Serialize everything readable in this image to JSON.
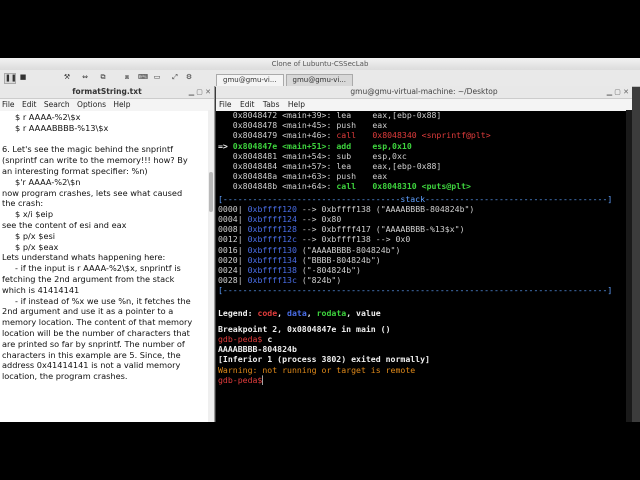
{
  "vm": {
    "title": "Clone of Lubuntu-CSSecLab",
    "pause_icon": "pause-icon",
    "tabs": [
      "gmu@gmu-vi...",
      "gmu@gmu-vi..."
    ]
  },
  "editor": {
    "title": "formatString.txt",
    "menu": [
      "File",
      "Edit",
      "Search",
      "Options",
      "Help"
    ],
    "lines": [
      "     $ r AAAA-%2\\$x",
      "     $ r AAAABBBB-%13\\$x",
      "",
      "6. Let's see the magic behind the snprintf",
      "(snprintf can write to the memory!!! how? By",
      "an interesting format specifier: %n)",
      "     $'r AAAA-%2\\$n",
      "now program crashes, lets see what caused",
      "the crash:",
      "     $ x/i $eip",
      "see the content of esi and eax",
      "     $ p/x $esi",
      "     $ p/x $eax",
      "Lets understand whats happening here:",
      "     - if the input is r AAAA-%2\\$x, snprintf is",
      "fetching the 2nd argument from the stack",
      "which is 41414141",
      "     - if instead of %x we use %n, it fetches the",
      "2nd argument and use it as a pointer to a",
      "memory location. The content of that memory",
      "location will be the number of characters that",
      "are printed so far by snprintf. The number of",
      "characters in this example are 5. Since, the",
      "address 0x41414141 is not a valid memory",
      "location, the program crashes."
    ]
  },
  "terminal": {
    "title": "gmu@gmu-virtual-machine: ~/Desktop",
    "menu": [
      "File",
      "Edit",
      "Tabs",
      "Help"
    ],
    "code": [
      {
        "arrow": "",
        "addr": "0x8048472",
        "sym": "<main+39>:",
        "op": "lea",
        "args": "eax,[ebp-0x88]",
        "hl": false
      },
      {
        "arrow": "",
        "addr": "0x8048478",
        "sym": "<main+45>:",
        "op": "push",
        "args": "eax",
        "hl": false
      },
      {
        "arrow": "",
        "addr": "0x8048479",
        "sym": "<main+46>:",
        "op": "call",
        "args": "0x8048340 <snprintf@plt>",
        "hl": false,
        "call": true
      },
      {
        "arrow": "=> ",
        "addr": "0x804847e",
        "sym": "<main+51>:",
        "op": "add",
        "args": "esp,0x10",
        "hl": true
      },
      {
        "arrow": "",
        "addr": "0x8048481",
        "sym": "<main+54>:",
        "op": "sub",
        "args": "esp,0xc",
        "hl": false
      },
      {
        "arrow": "",
        "addr": "0x8048484",
        "sym": "<main+57>:",
        "op": "lea",
        "args": "eax,[ebp-0x88]",
        "hl": false
      },
      {
        "arrow": "",
        "addr": "0x804848a",
        "sym": "<main+63>:",
        "op": "push",
        "args": "eax",
        "hl": false
      },
      {
        "arrow": "",
        "addr": "0x804848b",
        "sym": "<main+64>:",
        "op": "call",
        "args": "0x8048310 <puts@plt>",
        "hl": false,
        "call2": true
      }
    ],
    "stack_sep": "[------------------------------------stack-------------------------------------]",
    "stack": [
      {
        "off": "0000|",
        "addr": "0xbffff120",
        "rest": "--> 0xbffff138 (\"AAAABBBB-804824b\")"
      },
      {
        "off": "0004|",
        "addr": "0xbffff124",
        "rest": "--> 0x80"
      },
      {
        "off": "0008|",
        "addr": "0xbffff128",
        "rest": "--> 0xbffff417 (\"AAAABBBB-%13$x\")"
      },
      {
        "off": "0012|",
        "addr": "0xbffff12c",
        "rest": "--> 0xbffff138 --> 0x0"
      },
      {
        "off": "0016|",
        "addr": "0xbffff130",
        "rest": "(\"AAAABBBB-804824b\")"
      },
      {
        "off": "0020|",
        "addr": "0xbffff134",
        "rest": "(\"BBBB-804824b\")"
      },
      {
        "off": "0024|",
        "addr": "0xbffff138",
        "rest": "(\"-804824b\")"
      },
      {
        "off": "0028|",
        "addr": "0xbffff13c",
        "rest": "(\"824b\")"
      }
    ],
    "end_sep": "[------------------------------------------------------------------------------]",
    "legend_prefix": "Legend:",
    "legend": [
      "code",
      "data",
      "rodata",
      "value"
    ],
    "bp_line": "Breakpoint 2, 0x0804847e in main ()",
    "prompt": "gdb-peda$",
    "cmd": "c",
    "output1": "AAAABBBB-804824b",
    "output2": "[Inferior 1 (process 3802) exited normally]",
    "warning": "Warning: not running or target is remote",
    "prompt2": "gdb-peda$"
  }
}
